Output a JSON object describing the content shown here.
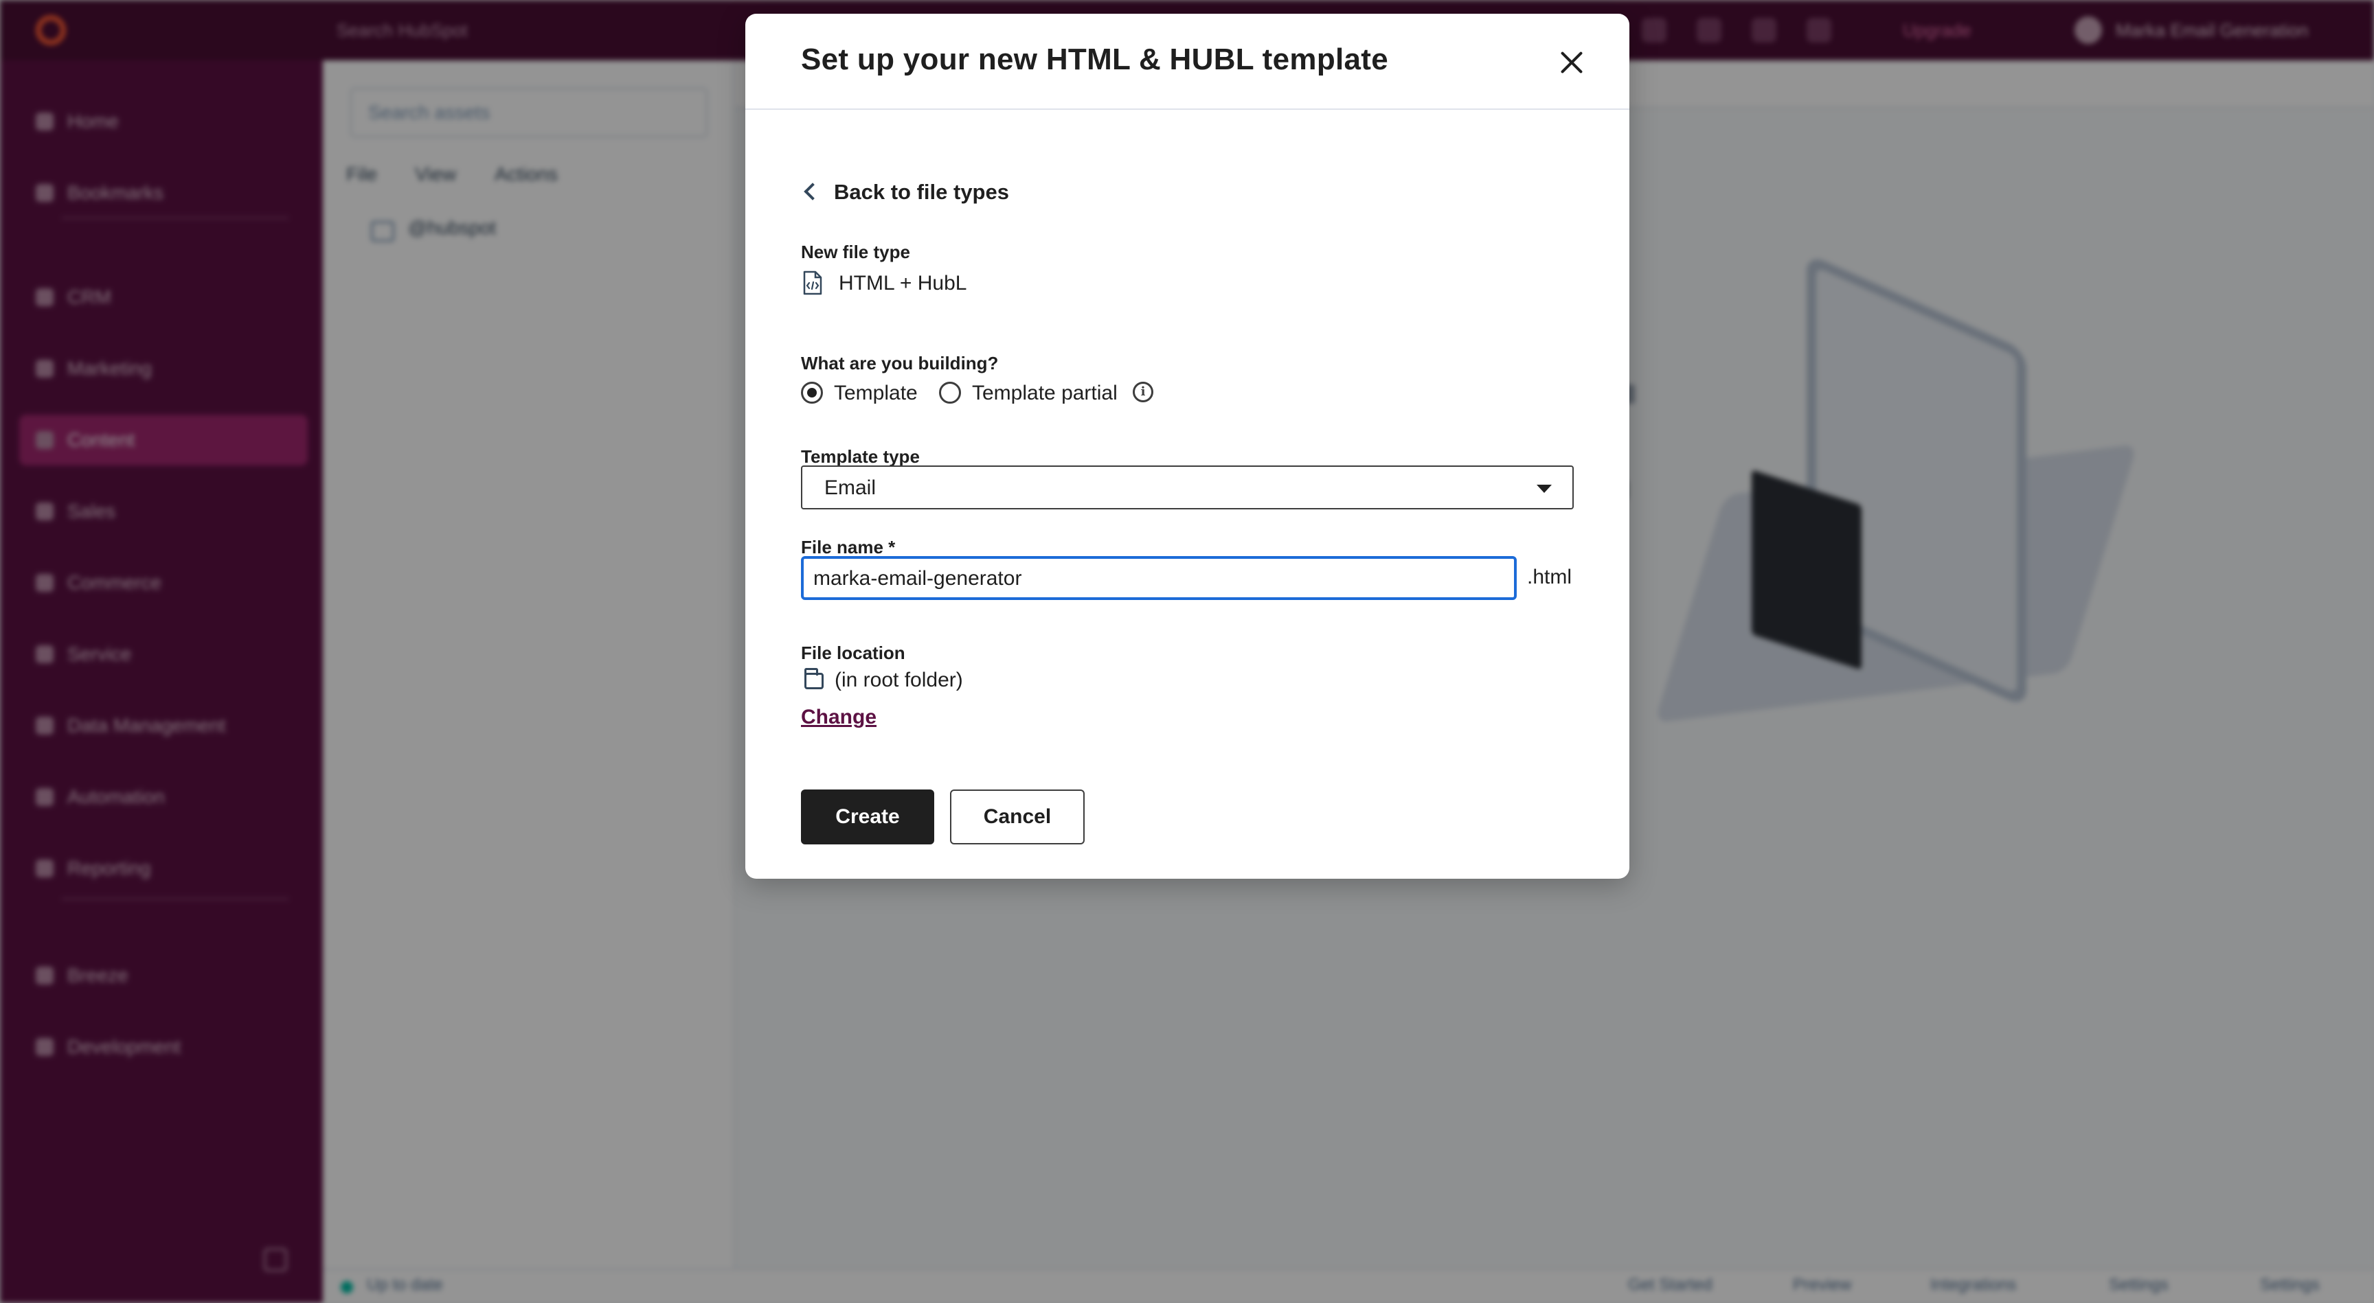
{
  "background": {
    "search_placeholder": "Search HubSpot",
    "upgrade": "Upgrade",
    "account": "Marka Email Generation",
    "nav": [
      "Home",
      "Bookmarks",
      "CRM",
      "Marketing",
      "Content",
      "Sales",
      "Commerce",
      "Service",
      "Data Management",
      "Automation",
      "Reporting",
      "Breeze",
      "Development"
    ],
    "file_search_placeholder": "Search assets",
    "file_menu": [
      "File",
      "View",
      "Actions"
    ],
    "folder": "@hubspot",
    "status_text": "Up to date",
    "status_items": [
      "Get Started",
      "Preview",
      "Integrations",
      "Settings",
      "Settings"
    ]
  },
  "modal": {
    "title": "Set up your new HTML & HUBL template",
    "back_label": "Back to file types",
    "new_file_type_label": "New file type",
    "new_file_type_value": "HTML + HubL",
    "building_label": "What are you building?",
    "options": [
      "Template",
      "Template partial"
    ],
    "template_type_label": "Template type",
    "template_type_value": "Email",
    "file_name_label": "File name *",
    "file_name_value": "marka-email-generator",
    "file_suffix": ".html",
    "file_location_label": "File location",
    "file_location_value": "(in root folder)",
    "change_label": "Change",
    "create_label": "Create",
    "cancel_label": "Cancel",
    "info_glyph": "i"
  },
  "colors": {
    "topbar": "#4a0e34",
    "sidebar": "#5c1143",
    "active_nav": "#a0276e",
    "focus_border": "#1c6bd8",
    "primary_button": "#1f1f1f",
    "link": "#5c1143"
  }
}
